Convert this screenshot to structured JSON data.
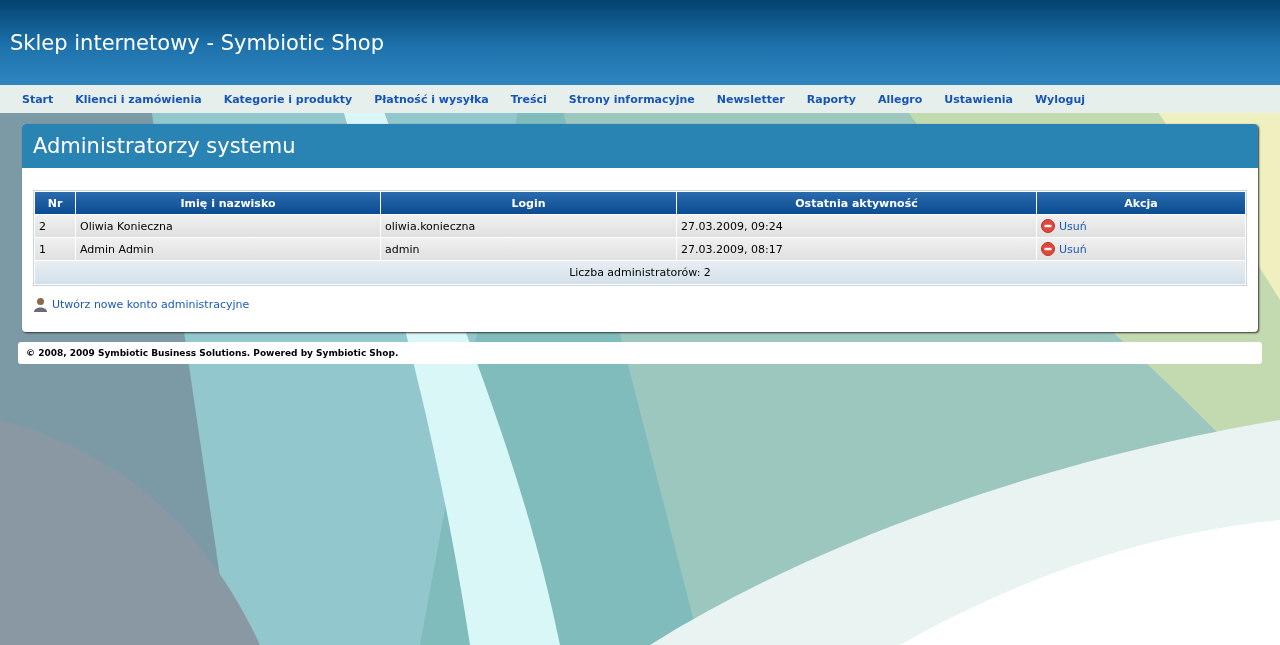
{
  "header": {
    "title": "Sklep internetowy - Symbiotic Shop"
  },
  "nav": [
    {
      "label": "Start"
    },
    {
      "label": "Klienci i zamówienia"
    },
    {
      "label": "Kategorie i produkty"
    },
    {
      "label": "Płatność i wysyłka"
    },
    {
      "label": "Treści"
    },
    {
      "label": "Strony informacyjne"
    },
    {
      "label": "Newsletter"
    },
    {
      "label": "Raporty"
    },
    {
      "label": "Allegro"
    },
    {
      "label": "Ustawienia"
    },
    {
      "label": "Wyloguj"
    }
  ],
  "panel": {
    "title": "Administratorzy systemu"
  },
  "table": {
    "columns": [
      "Nr",
      "Imię i nazwisko",
      "Login",
      "Ostatnia aktywność",
      "Akcja"
    ],
    "rows": [
      {
        "nr": "2",
        "name": "Oliwia Konieczna",
        "login": "oliwia.konieczna",
        "activity": "27.03.2009, 09:24",
        "action": "Usuń"
      },
      {
        "nr": "1",
        "name": "Admin Admin",
        "login": "admin",
        "activity": "27.03.2009, 08:17",
        "action": "Usuń"
      }
    ],
    "summary": "Liczba administratorów: 2"
  },
  "create_link": "Utwórz nowe konto administracyjne",
  "footer": "© 2008, 2009 Symbiotic Business Solutions. Powered by Symbiotic Shop."
}
